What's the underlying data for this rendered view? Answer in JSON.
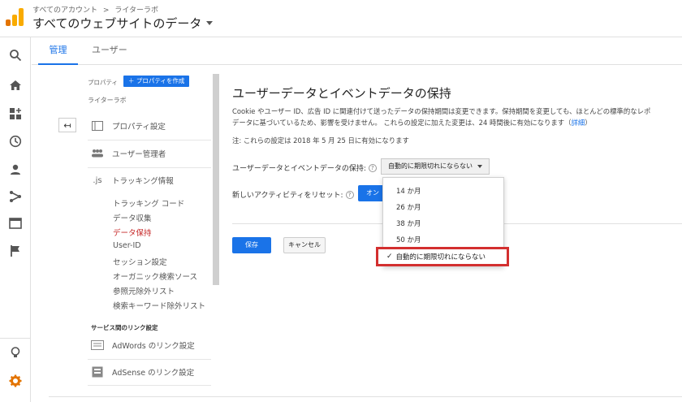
{
  "header": {
    "breadcrumb_root": "すべてのアカウント",
    "breadcrumb_sep": ">",
    "breadcrumb_account": "ライターラボ",
    "view_title": "すべてのウェブサイトのデータ"
  },
  "tabs": [
    {
      "label": "管理",
      "active": true
    },
    {
      "label": "ユーザー",
      "active": false
    }
  ],
  "admin": {
    "property_label": "プロパティ",
    "create_property": "＋ プロパティを作成",
    "property_name": "ライターラボ",
    "menu": [
      {
        "label": "プロパティ設定",
        "icon": "property-settings-icon"
      },
      {
        "label": "ユーザー管理者",
        "icon": "users-icon"
      },
      {
        "label": "トラッキング情報",
        "icon": "js-icon"
      }
    ],
    "tracking_sub": [
      {
        "label": "トラッキング コード",
        "active": false
      },
      {
        "label": "データ収集",
        "active": false
      },
      {
        "label": "データ保持",
        "active": true
      },
      {
        "label": "User-ID",
        "active": false
      },
      {
        "label": "セッション設定",
        "active": false
      },
      {
        "label": "オーガニック検索ソース",
        "active": false
      },
      {
        "label": "参照元除外リスト",
        "active": false
      },
      {
        "label": "検索キーワード除外リスト",
        "active": false
      }
    ],
    "link_section_title": "サービス間のリンク設定",
    "link_items": [
      {
        "label": "AdWords のリンク設定",
        "icon": "adwords-icon"
      },
      {
        "label": "AdSense のリンク設定",
        "icon": "adsense-icon"
      }
    ],
    "js_icon_text": ".js"
  },
  "main": {
    "title": "ユーザーデータとイベントデータの保持",
    "desc_line1": "Cookie やユーザー ID、広告 ID に関連付けて送ったデータの保持期間は変更できます。保持期間を変更しても、ほとんどの標準的なレポ",
    "desc_line2": "データに基づいているため、影響を受けません。 これらの設定に加えた変更は、24 時間後に有効になります（",
    "desc_link": "詳細",
    "desc_end": "）",
    "note": "注: これらの設定は 2018 年 5 月 25 日に有効になります",
    "retention_label": "ユーザーデータとイベントデータの保持:",
    "retention_value": "自動的に期限切れにならない",
    "reset_label": "新しいアクティビティをリセット:",
    "reset_toggle": "オン",
    "save": "保存",
    "cancel": "キャンセル",
    "help": "?"
  },
  "dropdown": {
    "options": [
      "14 か月",
      "26 か月",
      "38 か月",
      "50 か月"
    ],
    "selected": "自動的に期限切れにならない",
    "check": "✓"
  },
  "colors": {
    "accent": "#1a73e8",
    "active_sub": "#c62828",
    "highlight_border": "#d32f2f",
    "logo_orange": "#f9ab00",
    "logo_dark_orange": "#e37400"
  }
}
